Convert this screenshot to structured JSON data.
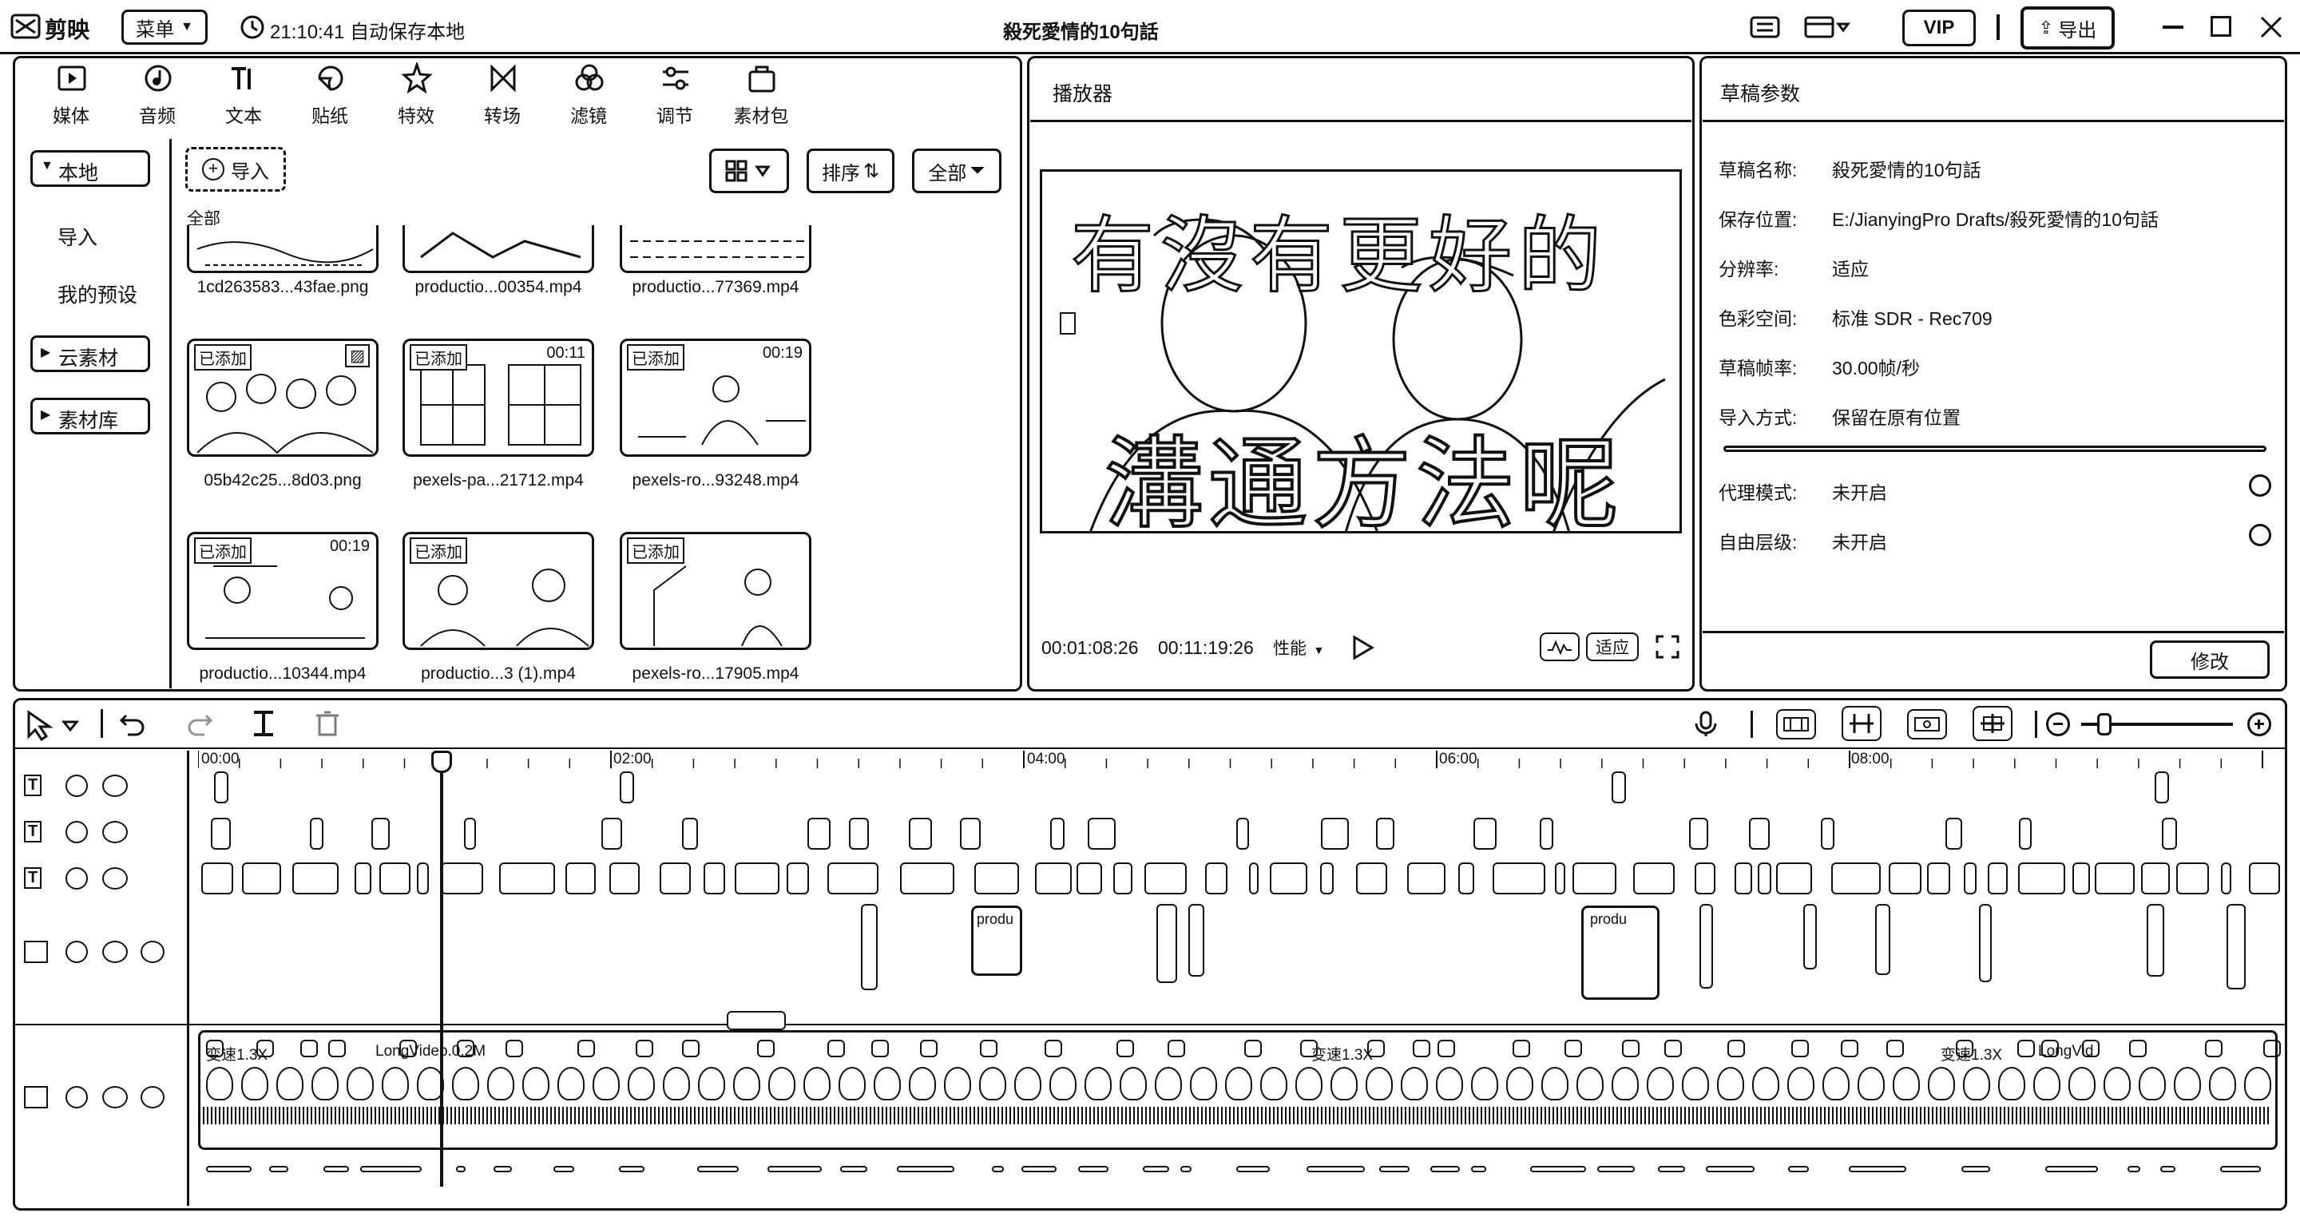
{
  "app": {
    "logo": "剪映",
    "menu_label": "菜单",
    "autosave_text": "21:10:41 自动保存本地",
    "project_title": "殺死愛情的10句話",
    "vip_label": "VIP",
    "export_label": "导出"
  },
  "tools": [
    {
      "label": "媒体",
      "icon": "media-icon"
    },
    {
      "label": "音频",
      "icon": "audio-icon"
    },
    {
      "label": "文本",
      "icon": "text-icon"
    },
    {
      "label": "贴纸",
      "icon": "sticker-icon"
    },
    {
      "label": "特效",
      "icon": "effects-icon"
    },
    {
      "label": "转场",
      "icon": "transition-icon"
    },
    {
      "label": "滤镜",
      "icon": "filter-icon"
    },
    {
      "label": "调节",
      "icon": "adjust-icon"
    },
    {
      "label": "素材包",
      "icon": "package-icon"
    }
  ],
  "sidebar": {
    "local": "本地",
    "import": "导入",
    "presets": "我的预设",
    "cloud": "云素材",
    "library": "素材库"
  },
  "media": {
    "import_button": "导入",
    "sort_label": "排序",
    "filter_label": "全部",
    "section_label": "全部",
    "top_row": [
      "1cd263583...43fae.png",
      "productio...00354.mp4",
      "productio...77369.mp4"
    ],
    "items": [
      {
        "name": "05b42c25...8d03.png",
        "tag": "已添加",
        "duration": ""
      },
      {
        "name": "pexels-pa...21712.mp4",
        "tag": "已添加",
        "duration": "00:11"
      },
      {
        "name": "pexels-ro...93248.mp4",
        "tag": "已添加",
        "duration": "00:19"
      },
      {
        "name": "productio...10344.mp4",
        "tag": "已添加",
        "duration": "00:19"
      },
      {
        "name": "productio...3 (1).mp4",
        "tag": "已添加",
        "duration": ""
      },
      {
        "name": "pexels-ro...17905.mp4",
        "tag": "已添加",
        "duration": ""
      }
    ]
  },
  "player": {
    "title": "播放器",
    "subtitle_top": "有沒有更好的",
    "subtitle_bottom": "溝通方法呢",
    "current_time": "00:01:08:26",
    "total_time": "00:11:19:26",
    "quality_label": "性能",
    "fit_label": "适应"
  },
  "draft": {
    "title": "草稿参数",
    "rows": [
      {
        "key": "草稿名称:",
        "value": "殺死愛情的10句話"
      },
      {
        "key": "保存位置:",
        "value": "E:/JianyingPro Drafts/殺死愛情的10句話"
      },
      {
        "key": "分辨率:",
        "value": "适应"
      },
      {
        "key": "色彩空间:",
        "value": "标准 SDR - Rec709"
      },
      {
        "key": "草稿帧率:",
        "value": "30.00帧/秒"
      },
      {
        "key": "导入方式:",
        "value": "保留在原有位置"
      }
    ],
    "proxy_key": "代理模式:",
    "proxy_value": "未开启",
    "layer_key": "自由层级:",
    "layer_value": "未开启",
    "modify_button": "修改"
  },
  "timeline": {
    "ruler": [
      "00:00",
      "02:00",
      "04:00",
      "06:00",
      "08:00"
    ],
    "clip_labels": {
      "overlay1": "produ",
      "overlay2": "produ",
      "speed1": "变速1.3X",
      "longvideo": "LongVideo.0.2M",
      "speed2": "变速1.3X",
      "speed3": "变速1.3X",
      "longvid2": "LongVid"
    }
  }
}
